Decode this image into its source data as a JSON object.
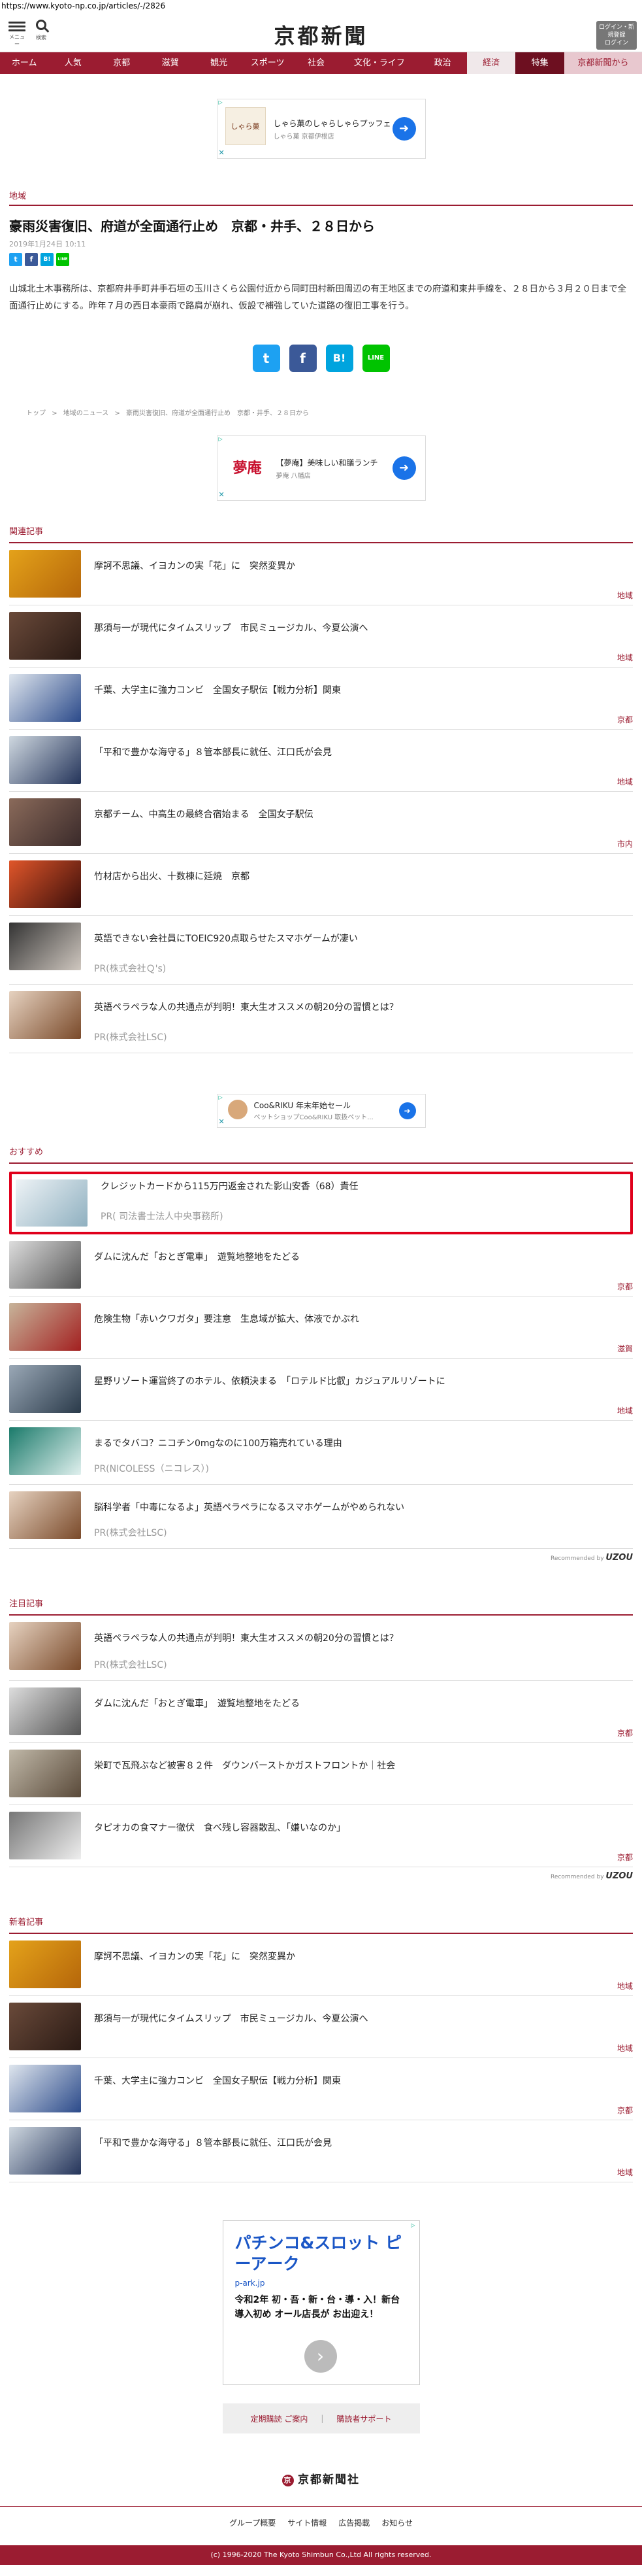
{
  "url": "https://www.kyoto-np.co.jp/articles/-/2826",
  "header": {
    "menu_label": "メニュー",
    "search_label": "検索",
    "logo": "京都新聞",
    "login_label": "ログイン・新規登録",
    "login_label2": "ログイン"
  },
  "nav": [
    "ホーム",
    "人気",
    "京都",
    "滋賀",
    "観光",
    "スポーツ",
    "社会",
    "文化・ライフ",
    "政治",
    "経済",
    "特集",
    "京都新聞から"
  ],
  "ad1": {
    "title": "しゃら菓のしゃらしゃらプッフェ",
    "sub": "しゃら菓 京都伊根店"
  },
  "article": {
    "section": "地域",
    "headline": "豪雨災害復旧、府道が全面通行止め　京都・井手、２８日から",
    "date": "2019年1月24日 10:11",
    "body": "山城北土木事務所は、京都府井手町井手石垣の玉川さくら公園付近から同町田村新田周辺の有王地区までの府道和束井手線を、２８日から３月２０日まで全面通行止めにする。昨年７月の西日本豪雨で路肩が崩れ、仮設で補強していた道路の復旧工事を行う。"
  },
  "share": {
    "tw": "t",
    "fb": "f",
    "hb": "B!",
    "line": "LINE"
  },
  "breadcrumbs": [
    "トップ",
    ">",
    "地域のニュース",
    ">",
    "豪雨災害復旧、府道が全面通行止め　京都・井手、２８日から"
  ],
  "ad2": {
    "title": "【夢庵】美味しい和膳ランチ",
    "sub": "夢庵 八幡店",
    "logo": "夢庵"
  },
  "related": {
    "label": "関連記事",
    "items": [
      {
        "title": "摩訶不思議、イヨカンの実「花」に　突然変異か",
        "cat": "地域"
      },
      {
        "title": "那須与一が現代にタイムスリップ　市民ミュージカル、今夏公演へ",
        "cat": "地域"
      },
      {
        "title": "千葉、大学主に強力コンビ　全国女子駅伝【戦力分析】関東",
        "cat": "京都"
      },
      {
        "title": "「平和で豊かな海守る」８管本部長に就任、江口氏が会見",
        "cat": "地域"
      },
      {
        "title": "京都チーム、中高生の最終合宿始まる　全国女子駅伝",
        "cat": "市内"
      },
      {
        "title": "竹材店から出火、十数棟に延焼　京都",
        "cat": ""
      },
      {
        "title": "英語できない会社員にTOEIC920点取らせたスマホゲームが凄い",
        "pr": "PR(株式会社Ｑ's)"
      },
      {
        "title": "英語ペラペラな人の共通点が判明！東大生オススメの朝20分の習慣とは？",
        "pr": "PR(株式会社LSC)"
      }
    ]
  },
  "ad3": {
    "title": "Coo&RIKU 年末年始セール",
    "sub": "ペットショップCoo&RIKU 取扱ペット..."
  },
  "recommend": {
    "label": "おすすめ",
    "items": [
      {
        "title": "クレジットカードから115万円返金された影山安香（68）責任",
        "pr": "PR( 司法書士法人中央事務所)"
      },
      {
        "title": "ダムに沈んだ「おとぎ電車」　遊覧地整地をたどる",
        "cat": "京都"
      },
      {
        "title": "危険生物「赤いクワガタ」要注意　生息域が拡大、体液でかぶれ",
        "cat": "滋賀"
      },
      {
        "title": "星野リゾート運営終了のホテル、依頼決まる　「ロテルド比叡」カジュアルリゾートに",
        "cat": "地域"
      },
      {
        "title": "まるでタバコ？ニコチン0mgなのに100万箱売れている理由",
        "pr": "PR(NICOLESS（ニコレス）)"
      },
      {
        "title": "脳科学者「中毒になるよ」英語ペラペラになるスマホゲームがやめられない",
        "pr": "PR(株式会社LSC)"
      }
    ],
    "by_label": "Recommended by",
    "by_brand": "UZOU"
  },
  "attention": {
    "label": "注目記事",
    "items": [
      {
        "title": "英語ペラペラな人の共通点が判明！東大生オススメの朝20分の習慣とは？",
        "pr": "PR(株式会社LSC)"
      },
      {
        "title": "ダムに沈んだ「おとぎ電車」　遊覧地整地をたどる",
        "cat": "京都"
      },
      {
        "title": "栄町で瓦飛ぶなど被害８２件　ダウンバーストかガストフロントか｜社会",
        "cat": ""
      },
      {
        "title": "タピオカの食マナー徹伏　食べ残し容器散乱、「嫌いなのか」",
        "cat": "京都"
      }
    ],
    "by_label": "Recommended by",
    "by_brand": "UZOU"
  },
  "latest": {
    "label": "新着記事",
    "items": [
      {
        "title": "摩訶不思議、イヨカンの実「花」に　突然変異か",
        "cat": "地域"
      },
      {
        "title": "那須与一が現代にタイムスリップ　市民ミュージカル、今夏公演へ",
        "cat": "地域"
      },
      {
        "title": "千葉、大学主に強力コンビ　全国女子駅伝【戦力分析】関東",
        "cat": "京都"
      },
      {
        "title": "「平和で豊かな海守る」８管本部長に就任、江口氏が会見",
        "cat": "地域"
      }
    ]
  },
  "bigad": {
    "title": "パチンコ&スロット ピーアーク",
    "domain": "p-ark.jp",
    "body": "令和2年 初・吾・新・台・導・入！新台導入初め オール店長が お出迎え！"
  },
  "sublinks": {
    "a": "定期購読 ご案内",
    "sep": "|",
    "b": "購読者サポート"
  },
  "footer": {
    "logo": "京都新聞社",
    "mark": "京",
    "links": [
      "グループ概要",
      "サイト情報",
      "広告掲載",
      "お知らせ"
    ],
    "copyright": "(c) 1996-2020 The Kyoto Shimbun Co.,Ltd All rights reserved."
  },
  "colors": {
    "brand": "#9b1c31",
    "twitter": "#1da1f2",
    "facebook": "#3b5998",
    "hatena": "#00a4de",
    "line": "#00c300",
    "highlight": "#e0001b"
  }
}
